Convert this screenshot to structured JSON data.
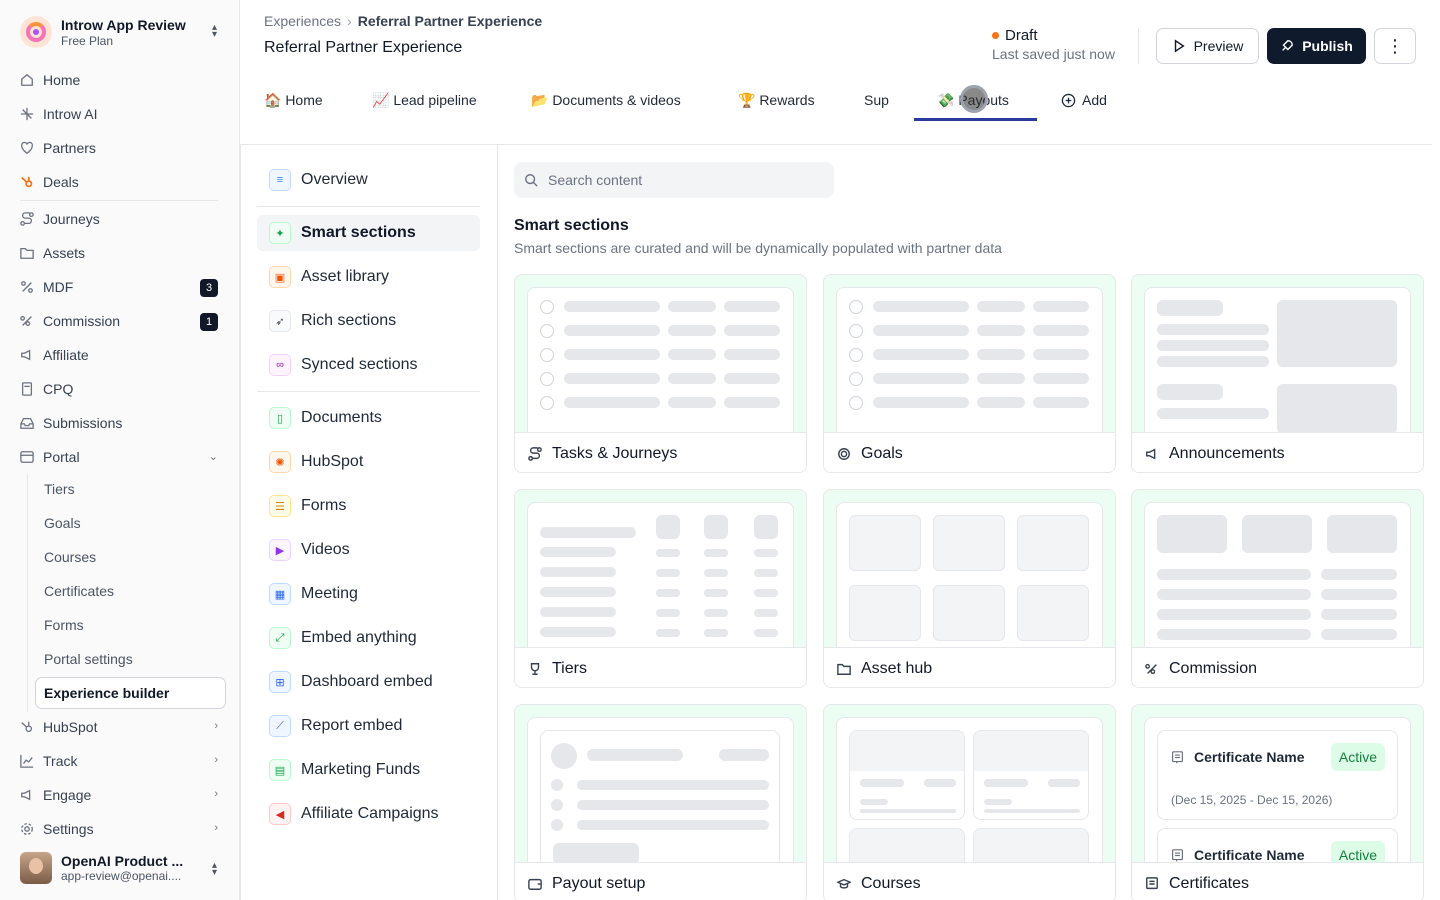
{
  "workspace": {
    "name": "Introw App Review",
    "plan": "Free Plan"
  },
  "sidebar": {
    "items": [
      {
        "label": "Home"
      },
      {
        "label": "Introw AI"
      },
      {
        "label": "Partners"
      },
      {
        "label": "Deals"
      },
      {
        "label": "Journeys"
      },
      {
        "label": "Assets"
      },
      {
        "label": "MDF",
        "badge": "3"
      },
      {
        "label": "Commission",
        "badge": "1"
      },
      {
        "label": "Affiliate"
      },
      {
        "label": "CPQ"
      },
      {
        "label": "Submissions"
      },
      {
        "label": "Portal"
      }
    ],
    "portal_sub": [
      "Tiers",
      "Goals",
      "Courses",
      "Certificates",
      "Forms",
      "Portal settings",
      "Experience builder"
    ],
    "bottom": [
      {
        "label": "HubSpot"
      },
      {
        "label": "Track"
      },
      {
        "label": "Engage"
      },
      {
        "label": "Settings"
      }
    ]
  },
  "user": {
    "name": "OpenAI Product ...",
    "email": "app-review@openai...."
  },
  "header": {
    "breadcrumb_root": "Experiences",
    "breadcrumb_current": "Referral Partner Experience",
    "title": "Referral Partner Experience",
    "status": "Draft",
    "saved": "Last saved just now",
    "preview_label": "Preview",
    "publish_label": "Publish",
    "more_label": "⋮"
  },
  "tabs": [
    {
      "label": "🏠 Home"
    },
    {
      "label": "📈 Lead pipeline"
    },
    {
      "label": "📂 Documents & videos"
    },
    {
      "label": "🏆 Rewards"
    },
    {
      "label": "Sup"
    },
    {
      "label": "💸 Payouts"
    },
    {
      "label": "Add"
    }
  ],
  "active_tab": "💸 Payouts",
  "library": {
    "groups": [
      [
        "Overview"
      ],
      [
        "Smart sections",
        "Asset library",
        "Rich sections",
        "Synced sections"
      ],
      [
        "Documents",
        "HubSpot",
        "Forms",
        "Videos",
        "Meeting",
        "Embed anything",
        "Dashboard embed",
        "Report embed",
        "Marketing Funds",
        "Affiliate Campaigns"
      ]
    ],
    "active": "Smart sections"
  },
  "content": {
    "search_placeholder": "Search content",
    "section_title": "Smart sections",
    "section_subtitle": "Smart sections are curated and will be dynamically populated with partner data",
    "cards": [
      "Tasks & Journeys",
      "Goals",
      "Announcements",
      "Tiers",
      "Asset hub",
      "Commission",
      "Payout setup",
      "Courses",
      "Certificates"
    ],
    "certificate_preview": {
      "name": "Certificate Name",
      "status": "Active",
      "dates": "(Dec 15, 2025 - Dec 15, 2026)"
    }
  },
  "colors": {
    "accent": "#2b3a9e",
    "publish_bg": "#0f1b2d",
    "draft_dot": "#f97316",
    "card_preview_bg": "#ecfdf3"
  }
}
